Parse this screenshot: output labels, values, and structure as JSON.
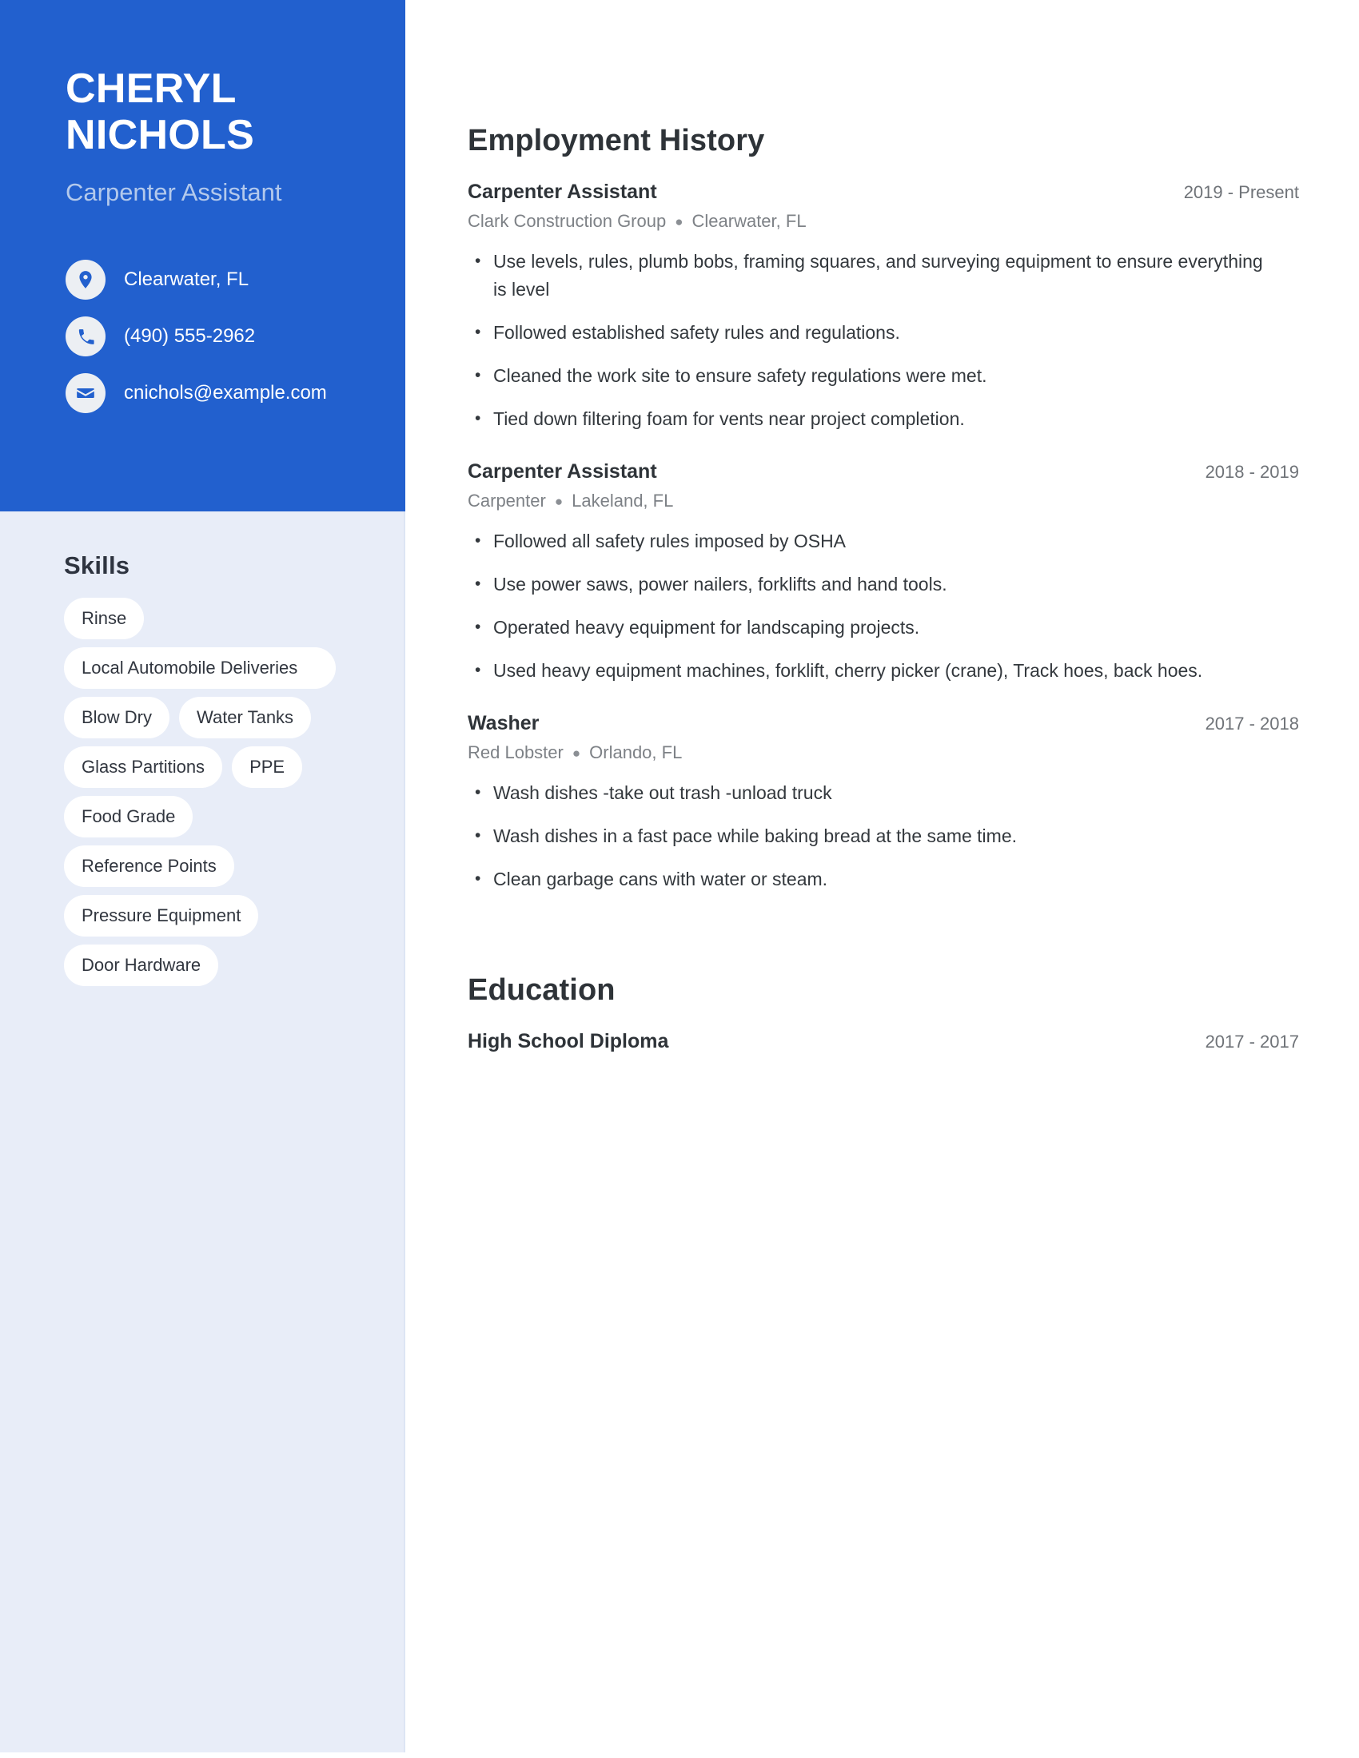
{
  "theme": {
    "primary_blue": "#2260ce",
    "sidebar_bg": "#e8edf8",
    "pill_bg": "#ffffff",
    "heading_color": "#2e3338",
    "muted_text": "#7d8186"
  },
  "sidebar": {
    "name_first": "CHERYL",
    "name_last": "NICHOLS",
    "job_title": "Carpenter Assistant",
    "contacts": [
      {
        "icon": "location-pin-icon",
        "value": "Clearwater, FL"
      },
      {
        "icon": "phone-icon",
        "value": "(490) 555-2962"
      },
      {
        "icon": "email-icon",
        "value": "cnichols@example.com"
      }
    ],
    "skills_heading": "Skills",
    "skills": [
      "Rinse",
      "Local Automobile Deliveries",
      "Blow Dry",
      "Water Tanks",
      "Glass Partitions",
      "PPE",
      "Food Grade",
      "Reference Points",
      "Pressure Equipment",
      "Door Hardware"
    ]
  },
  "main": {
    "employment_heading": "Employment History",
    "education_heading": "Education",
    "jobs": [
      {
        "title": "Carpenter Assistant",
        "date": "2019 - Present",
        "company": "Clark Construction Group",
        "location": "Clearwater, FL",
        "bullets": [
          "Use levels, rules, plumb bobs, framing squares, and surveying equipment to ensure everything is level",
          "Followed established safety rules and regulations.",
          "Cleaned the work site to ensure safety regulations were met.",
          "Tied down filtering foam for vents near project completion."
        ]
      },
      {
        "title": "Carpenter Assistant",
        "date": "2018 - 2019",
        "company": "Carpenter",
        "location": "Lakeland, FL",
        "bullets": [
          "Followed all safety rules imposed by OSHA",
          "Use power saws, power nailers, forklifts and hand tools.",
          "Operated heavy equipment for landscaping projects.",
          "Used heavy equipment machines, forklift, cherry picker (crane), Track hoes, back hoes."
        ]
      },
      {
        "title": "Washer",
        "date": "2017 - 2018",
        "company": "Red Lobster",
        "location": "Orlando, FL",
        "bullets": [
          "Wash dishes -take out trash -unload truck",
          "Wash dishes in a fast pace while baking bread at the same time.",
          "Clean garbage cans with water or steam."
        ]
      }
    ],
    "education": [
      {
        "title": "High School Diploma",
        "date": "2017 - 2017"
      }
    ]
  }
}
